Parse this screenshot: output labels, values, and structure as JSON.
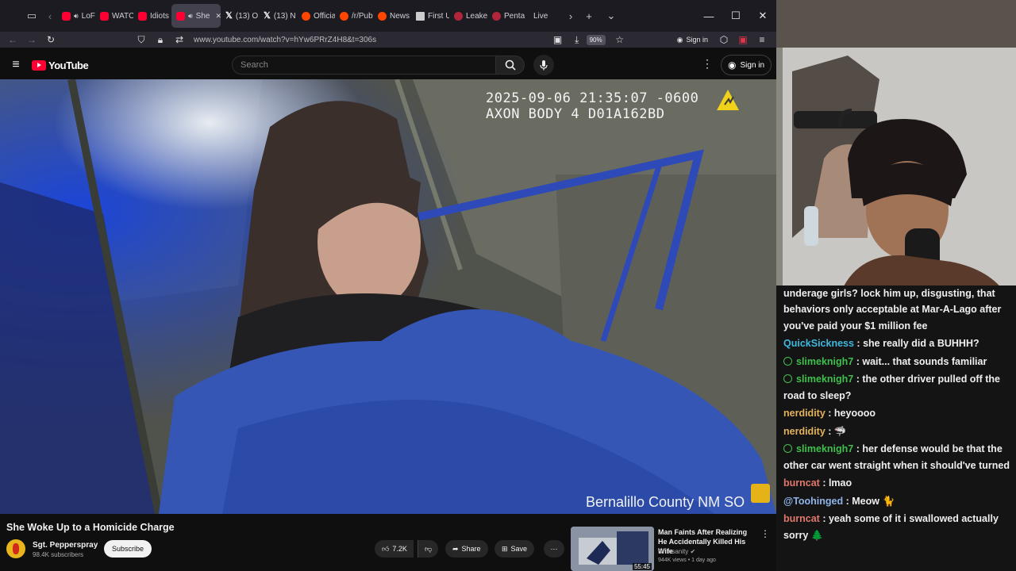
{
  "browser": {
    "tabs": [
      {
        "label": "LoFi D",
        "icon": "youtube",
        "audio": true
      },
      {
        "label": "WATC",
        "icon": "youtube"
      },
      {
        "label": "Idiots",
        "icon": "youtube"
      },
      {
        "label": "She",
        "icon": "youtube",
        "audio": true,
        "active": true
      },
      {
        "label": "(13) O",
        "icon": "x"
      },
      {
        "label": "(13) N",
        "icon": "x"
      },
      {
        "label": "Officia",
        "icon": "reddit"
      },
      {
        "label": "/r/Pub",
        "icon": "reddit"
      },
      {
        "label": "News",
        "icon": "reddit"
      },
      {
        "label": "First U",
        "icon": "document"
      },
      {
        "label": "Leake",
        "icon": "circle"
      },
      {
        "label": "Penta",
        "icon": "circle"
      },
      {
        "label": "Live",
        "icon": "none"
      }
    ],
    "url": "www.youtube.com/watch?v=hYw6PRrZ4H8&t=306s",
    "zoom": "90%",
    "sign_in": "Sign in"
  },
  "youtube": {
    "logo_text": "YouTube",
    "search_placeholder": "Search",
    "sign_in": "Sign in"
  },
  "video": {
    "timestamp_line1": "2025-09-06 21:35:07 -0600",
    "timestamp_line2": "AXON BODY 4 D01A162BD",
    "overlay_caption": "Bernalillo County NM SO",
    "title": "She Woke Up to a Homicide Charge",
    "channel": "Sgt. Pepperspray",
    "subscribers": "98.4K subscribers",
    "subscribe_label": "Subscribe",
    "likes": "7.2K",
    "share_label": "Share",
    "save_label": "Save"
  },
  "recommended": {
    "title": "Man Faints After Realizing He Accidentally Killed His Wife",
    "channel": "Dr Insanity",
    "meta": "944K views • 1 day ago",
    "duration": "55:45"
  },
  "chat": [
    {
      "user": "",
      "text": "behaviors only acceptable at Mar-A-Lago after you've paid your $1 million fee",
      "lead": "underage girls? lock him up, disgusting, that",
      "color": "#efefef"
    },
    {
      "user": "QuickSickness",
      "text": "she really did a BUHHH?",
      "color": "#3fb8e0"
    },
    {
      "user": "slimeknigh7",
      "text": "wait... that sounds familiar",
      "color": "#3fbf4d",
      "badge": true
    },
    {
      "user": "slimeknigh7",
      "text": "the other driver pulled off the road to sleep?",
      "color": "#3fbf4d",
      "badge": true
    },
    {
      "user": "nerdidity",
      "text": "heyoooo",
      "color": "#e3b35a"
    },
    {
      "user": "nerdidity",
      "text": "🦈",
      "color": "#e3b35a"
    },
    {
      "user": "slimeknigh7",
      "text": "her defense would be that the other car went straight when it should've turned",
      "color": "#3fbf4d",
      "badge": true
    },
    {
      "user": "burncat",
      "text": "lmao",
      "color": "#e0786b"
    },
    {
      "user": "@Toohinged",
      "text": "Meow 🐈",
      "color": "#8fb4ea"
    },
    {
      "user": "burncat",
      "text": "yeah some of it i swallowed actually sorry 🌲",
      "color": "#e0786b"
    }
  ]
}
